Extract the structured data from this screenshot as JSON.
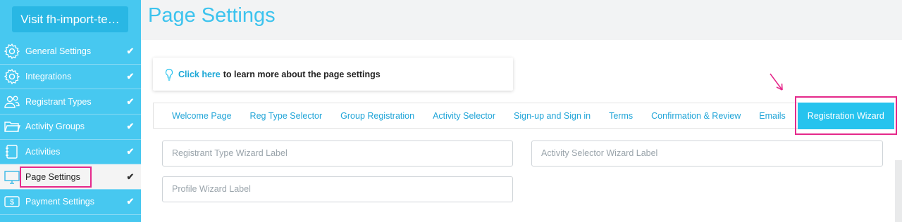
{
  "sidebar": {
    "visit_button": "Visit fh-import-te…",
    "items": [
      {
        "label": "General Settings",
        "icon": "gear-icon",
        "check": "✔"
      },
      {
        "label": "Integrations",
        "icon": "gear-icon",
        "check": "✔"
      },
      {
        "label": "Registrant Types",
        "icon": "users-icon",
        "check": "✔"
      },
      {
        "label": "Activity Groups",
        "icon": "folder-icon",
        "check": "✔"
      },
      {
        "label": "Activities",
        "icon": "notebook-icon",
        "check": "✔"
      },
      {
        "label": "Page Settings",
        "icon": "monitor-icon",
        "check": "✔"
      },
      {
        "label": "Payment Settings",
        "icon": "dollar-icon",
        "check": "✔"
      }
    ]
  },
  "page": {
    "title": "Page Settings",
    "info_link": "Click here",
    "info_text": "to learn more about the page settings"
  },
  "tabs": [
    "Welcome Page",
    "Reg Type Selector",
    "Group Registration",
    "Activity Selector",
    "Sign-up and Sign in",
    "Terms",
    "Confirmation & Review",
    "Emails",
    "Registration Wizard"
  ],
  "fields": {
    "registrant_type_placeholder": "Registrant Type Wizard Label",
    "activity_selector_placeholder": "Activity Selector Wizard Label",
    "profile_placeholder": "Profile Wizard Label"
  },
  "colors": {
    "sidebar": "#47c8f0",
    "accent": "#26c3ee",
    "highlight": "#e5298b"
  }
}
